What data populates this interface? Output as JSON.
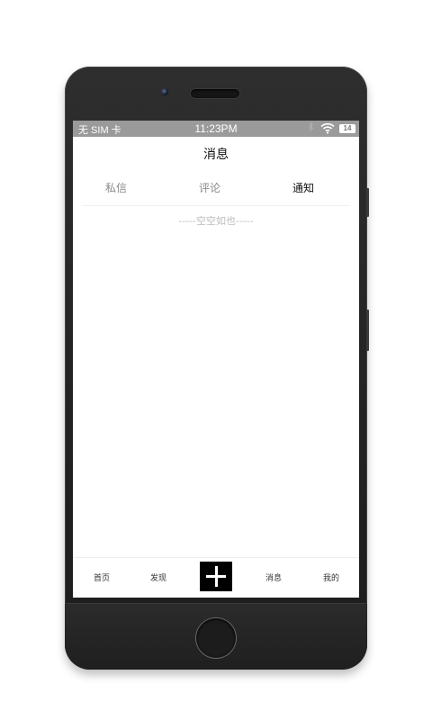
{
  "status_bar": {
    "carrier": "无 SIM 卡",
    "time": "11:23PM",
    "battery": "14",
    "icons": [
      "bluetooth-icon",
      "wifi-icon",
      "battery-icon"
    ]
  },
  "header": {
    "title": "消息"
  },
  "tabs": [
    {
      "label": "私信",
      "active": false
    },
    {
      "label": "评论",
      "active": false
    },
    {
      "label": "通知",
      "active": true
    }
  ],
  "content": {
    "empty_text": "-----空空如也-----"
  },
  "tab_bar": {
    "items": [
      {
        "label": "首页"
      },
      {
        "label": "发现"
      },
      {
        "label": "消息"
      },
      {
        "label": "我的"
      }
    ],
    "center_icon": "plus-icon"
  },
  "colors": {
    "status_bar_bg": "#9a9a9a",
    "active_tab": "#111111",
    "inactive_tab": "#8a8a8a",
    "add_button_bg": "#000000"
  }
}
